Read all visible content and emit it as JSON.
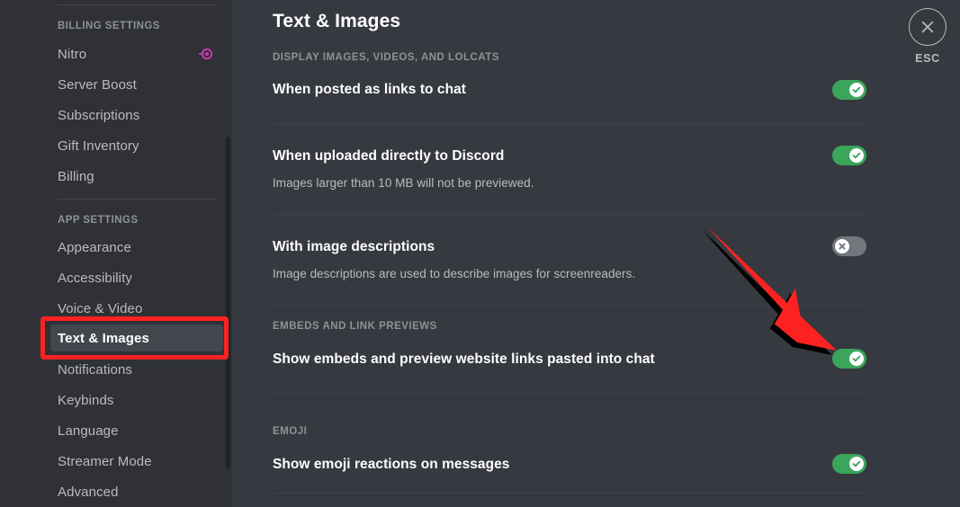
{
  "sidebar": {
    "sections": [
      {
        "header": "BILLING SETTINGS",
        "items": [
          {
            "label": "Nitro",
            "badge": "nitro-wheel-icon"
          },
          {
            "label": "Server Boost"
          },
          {
            "label": "Subscriptions"
          },
          {
            "label": "Gift Inventory"
          },
          {
            "label": "Billing"
          }
        ]
      },
      {
        "header": "APP SETTINGS",
        "items": [
          {
            "label": "Appearance"
          },
          {
            "label": "Accessibility"
          },
          {
            "label": "Voice & Video"
          },
          {
            "label": "Text & Images",
            "selected": true
          },
          {
            "label": "Notifications"
          },
          {
            "label": "Keybinds"
          },
          {
            "label": "Language"
          },
          {
            "label": "Streamer Mode"
          },
          {
            "label": "Advanced"
          }
        ]
      }
    ]
  },
  "main": {
    "title": "Text & Images",
    "sections": [
      {
        "header": "DISPLAY IMAGES, VIDEOS, AND LOLCATS",
        "rows": [
          {
            "title": "When posted as links to chat",
            "desc": "",
            "toggle": "on"
          },
          {
            "title": "When uploaded directly to Discord",
            "desc": "Images larger than 10 MB will not be previewed.",
            "toggle": "on"
          },
          {
            "title": "With image descriptions",
            "desc": "Image descriptions are used to describe images for screenreaders.",
            "toggle": "off"
          }
        ]
      },
      {
        "header": "EMBEDS AND LINK PREVIEWS",
        "rows": [
          {
            "title": "Show embeds and preview website links pasted into chat",
            "desc": "",
            "toggle": "on"
          }
        ]
      },
      {
        "header": "EMOJI",
        "rows": [
          {
            "title": "Show emoji reactions on messages",
            "desc": "",
            "toggle": "on"
          }
        ]
      }
    ]
  },
  "close": {
    "label": "ESC",
    "icon": "close-x-icon"
  },
  "annotations": {
    "highlight_target": "Text & Images",
    "arrow_target": "Show embeds and preview website links pasted into chat",
    "color": "#fc2222"
  },
  "colors": {
    "sidebar_bg": "#2f3136",
    "content_bg": "#36393f",
    "selected_bg": "#42464d",
    "toggle_on": "#3ba55c",
    "toggle_off": "#72767d",
    "annotation_red": "#fc2222",
    "nitro_pink": "#c837ab"
  }
}
